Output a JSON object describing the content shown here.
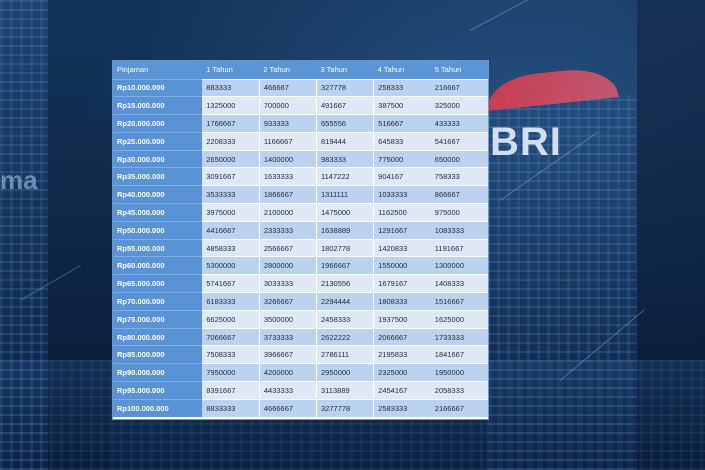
{
  "bg": {
    "brand_text": "BRI",
    "sign_text": "ma"
  },
  "table": {
    "headers": [
      "Pinjaman",
      "1 Tahun",
      "2 Tahun",
      "3 Tahun",
      "4 Tahun",
      "5 Tahun"
    ],
    "rows": [
      [
        "Rp10.000.000",
        "883333",
        "466667",
        "327778",
        "258333",
        "216667"
      ],
      [
        "Rp15.000.000",
        "1325000",
        "700000",
        "491667",
        "387500",
        "325000"
      ],
      [
        "Rp20.000.000",
        "1766667",
        "933333",
        "655556",
        "516667",
        "433333"
      ],
      [
        "Rp25.000.000",
        "2208333",
        "1166667",
        "819444",
        "645833",
        "541667"
      ],
      [
        "Rp30.000.000",
        "2650000",
        "1400000",
        "983333",
        "775000",
        "650000"
      ],
      [
        "Rp35.000.000",
        "3091667",
        "1633333",
        "1147222",
        "904167",
        "758333"
      ],
      [
        "Rp40.000.000",
        "3533333",
        "1866667",
        "1311111",
        "1033333",
        "866667"
      ],
      [
        "Rp45.000.000",
        "3975000",
        "2100000",
        "1475000",
        "1162500",
        "975000"
      ],
      [
        "Rp50.000.000",
        "4416667",
        "2333333",
        "1638889",
        "1291667",
        "1083333"
      ],
      [
        "Rp55.000.000",
        "4858333",
        "2566667",
        "1802778",
        "1420833",
        "1191667"
      ],
      [
        "Rp60.000.000",
        "5300000",
        "2800000",
        "1966667",
        "1550000",
        "1300000"
      ],
      [
        "Rp65.000.000",
        "5741667",
        "3033333",
        "2130556",
        "1679167",
        "1408333"
      ],
      [
        "Rp70.000.000",
        "6183333",
        "3266667",
        "2294444",
        "1808333",
        "1516667"
      ],
      [
        "Rp75.000.000",
        "6625000",
        "3500000",
        "2458333",
        "1937500",
        "1625000"
      ],
      [
        "Rp80.000.000",
        "7066667",
        "3733333",
        "2622222",
        "2066667",
        "1733333"
      ],
      [
        "Rp85.000.000",
        "7508333",
        "3966667",
        "2786111",
        "2195833",
        "1841667"
      ],
      [
        "Rp90.000.000",
        "7950000",
        "4200000",
        "2950000",
        "2325000",
        "1950000"
      ],
      [
        "Rp95.000.000",
        "8391667",
        "4433333",
        "3113889",
        "2454167",
        "2058333"
      ],
      [
        "Rp100.000.000",
        "8833333",
        "4666667",
        "3277778",
        "2583333",
        "2166667"
      ]
    ]
  }
}
